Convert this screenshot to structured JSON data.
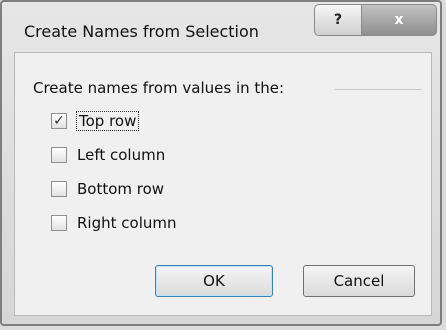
{
  "window": {
    "title": "Create Names from Selection",
    "help_label": "?",
    "close_label": "x"
  },
  "group": {
    "label": "Create names from values in the:"
  },
  "options": [
    {
      "label": "Top row",
      "checked": true
    },
    {
      "label": "Left column",
      "checked": false
    },
    {
      "label": "Bottom row",
      "checked": false
    },
    {
      "label": "Right column",
      "checked": false
    }
  ],
  "buttons": {
    "ok": "OK",
    "cancel": "Cancel"
  },
  "checkmark": "✓"
}
